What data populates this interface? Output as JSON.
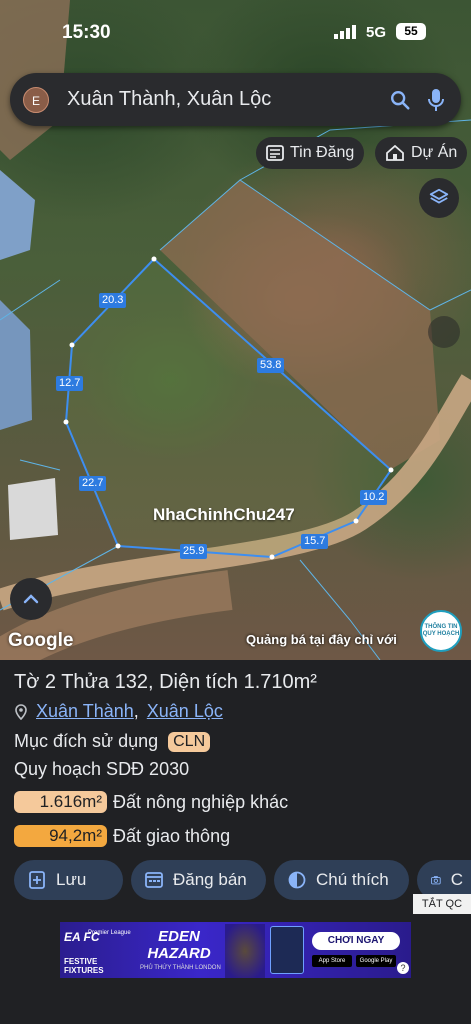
{
  "status_bar": {
    "time": "15:30",
    "network": "5G",
    "battery": "55"
  },
  "search": {
    "avatar_letter": "E",
    "query": "Xuân Thành, Xuân Lộc"
  },
  "chips": {
    "listings": "Tin Đăng",
    "projects": "Dự Án"
  },
  "map": {
    "watermark": "NhaChinhChu247",
    "edge_lengths": [
      "20.3",
      "12.7",
      "22.7",
      "25.9",
      "15.7",
      "10.2",
      "53.8"
    ],
    "google_label": "Google",
    "ad_text": "Quảng bá tại đây chỉ với",
    "tag_label": "THÔNG TIN QUY HOẠCH"
  },
  "parcel": {
    "title": "Tờ 2 Thửa 132, Diện tích 1.710m²",
    "location": {
      "ward": "Xuân Thành",
      "sep": ",",
      "district": "Xuân Lộc"
    },
    "purpose_label": "Mục đích sử dụng",
    "purpose_code": "CLN",
    "plan_label": "Quy hoạch SDĐ 2030",
    "zones": [
      {
        "area": "1.616m²",
        "name": "Đất nông nghiệp khác",
        "color": "#f5c99b"
      },
      {
        "area": "94,2m²",
        "name": "Đất giao thông",
        "color": "#f3a83f"
      }
    ]
  },
  "actions": {
    "save": "Lưu",
    "post": "Đăng bán",
    "legend": "Chú thích",
    "capture": "C"
  },
  "ad": {
    "close_label": "TẮT QC",
    "brand": "EA FC",
    "league": "Premier League",
    "fixtures": "FESTIVE FIXTURES",
    "player": "EDEN HAZARD",
    "subtitle": "PHỦ THỨY THÀNH LONDON",
    "cta": "CHƠI NGAY",
    "store1": "App Store",
    "store2": "Google Play"
  }
}
